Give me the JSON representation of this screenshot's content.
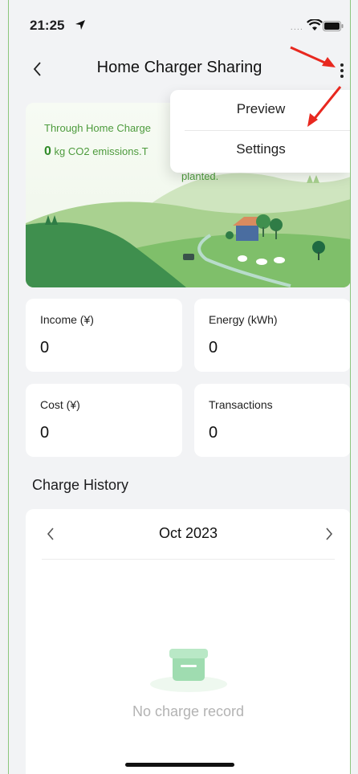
{
  "status_bar": {
    "time": "21:25",
    "signal": "....",
    "wifi": "wifi-icon",
    "battery": "battery-icon"
  },
  "nav": {
    "title": "Home Charger Sharing",
    "back_icon": "chevron-left-icon",
    "more_icon": "more-vertical-icon"
  },
  "hero": {
    "line1": "Through Home Charge",
    "co2_value": "0",
    "line2_rest": " kg CO2 emissions.T",
    "line3": "planted."
  },
  "menu": {
    "items": [
      "Preview",
      "Settings"
    ]
  },
  "stats": [
    {
      "label": "Income (¥)",
      "value": "0"
    },
    {
      "label": "Energy (kWh)",
      "value": "0"
    },
    {
      "label": "Cost (¥)",
      "value": "0"
    },
    {
      "label": "Transactions",
      "value": "0"
    }
  ],
  "history": {
    "title": "Charge History",
    "month": "Oct 2023",
    "empty_text": "No charge record"
  },
  "colors": {
    "accent_green": "#4d9b3d",
    "annotation_red": "#e8281f"
  }
}
